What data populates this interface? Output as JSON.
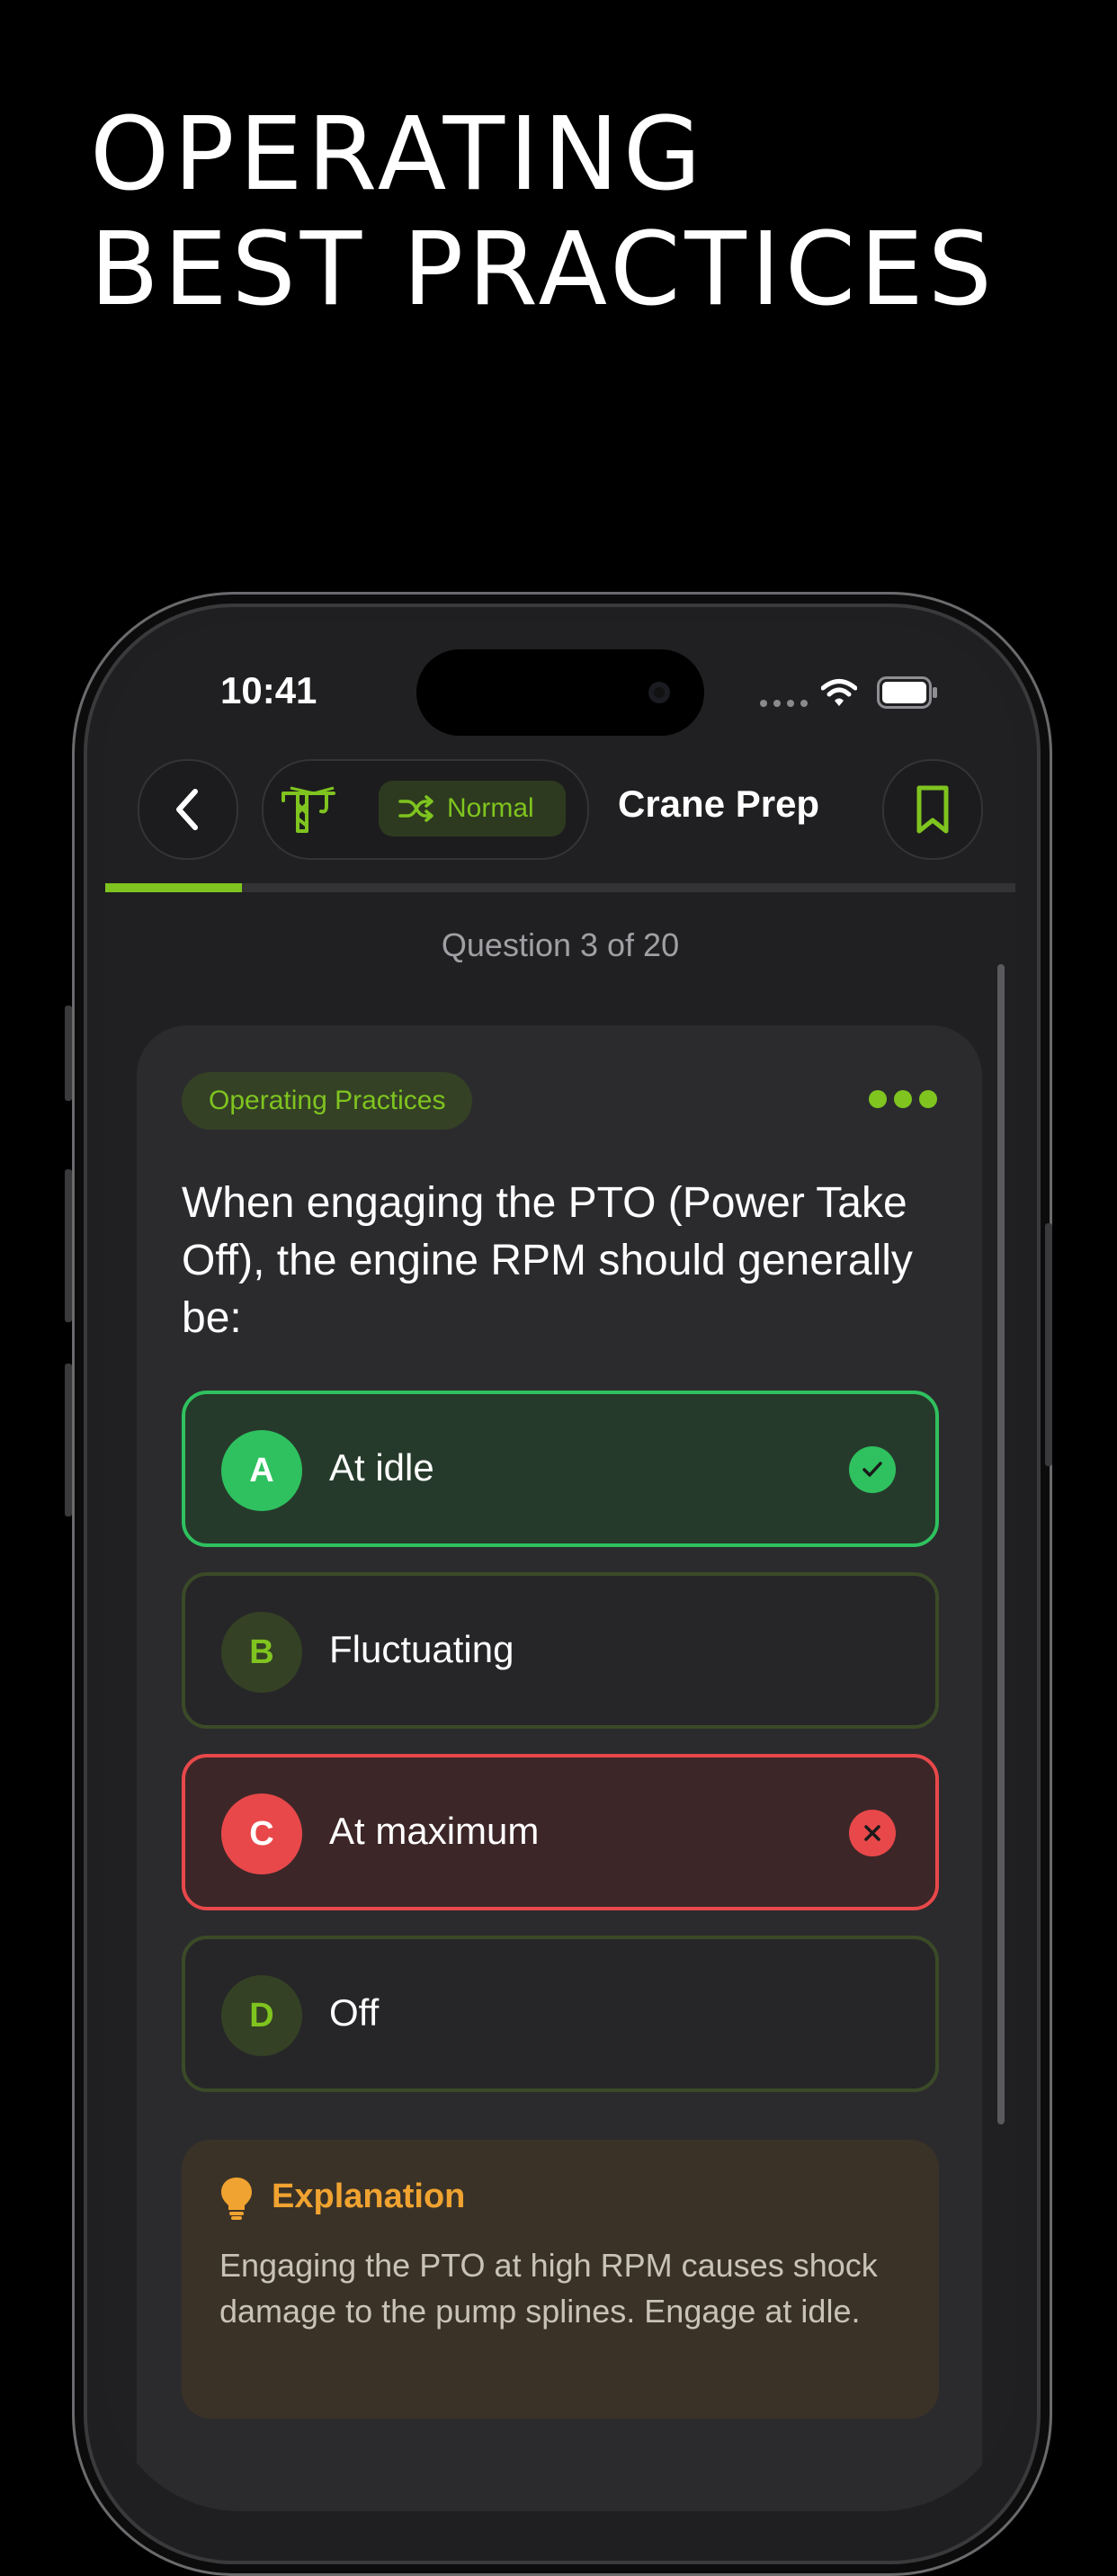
{
  "headline": {
    "line1": "OPERATING",
    "line2": "BEST PRACTICES"
  },
  "status_bar": {
    "time": "10:41"
  },
  "header": {
    "mode_label": "Normal",
    "title": "Crane Prep",
    "icons": {
      "back": "chevron-left-icon",
      "crane": "crane-icon",
      "shuffle": "shuffle-icon",
      "bookmark": "bookmark-icon"
    }
  },
  "progress": {
    "current": 3,
    "total": 20,
    "fraction": 0.15
  },
  "question": {
    "counter": "Question 3 of 20",
    "category": "Operating Practices",
    "text": "When engaging the PTO (Power Take Off), the engine RPM should generally be:",
    "options": [
      {
        "letter": "A",
        "text": "At idle",
        "state": "correct"
      },
      {
        "letter": "B",
        "text": "Fluctuating",
        "state": "neutral"
      },
      {
        "letter": "C",
        "text": "At maximum",
        "state": "wrong"
      },
      {
        "letter": "D",
        "text": "Off",
        "state": "neutral"
      }
    ]
  },
  "explanation": {
    "title": "Explanation",
    "body": "Engaging the PTO at high RPM causes shock damage to the pump splines. Engage at idle."
  },
  "colors": {
    "accent": "#7fc41f",
    "correct": "#2fc15f",
    "wrong": "#e8484a",
    "explanation": "#f0a330",
    "background": "#000000"
  }
}
